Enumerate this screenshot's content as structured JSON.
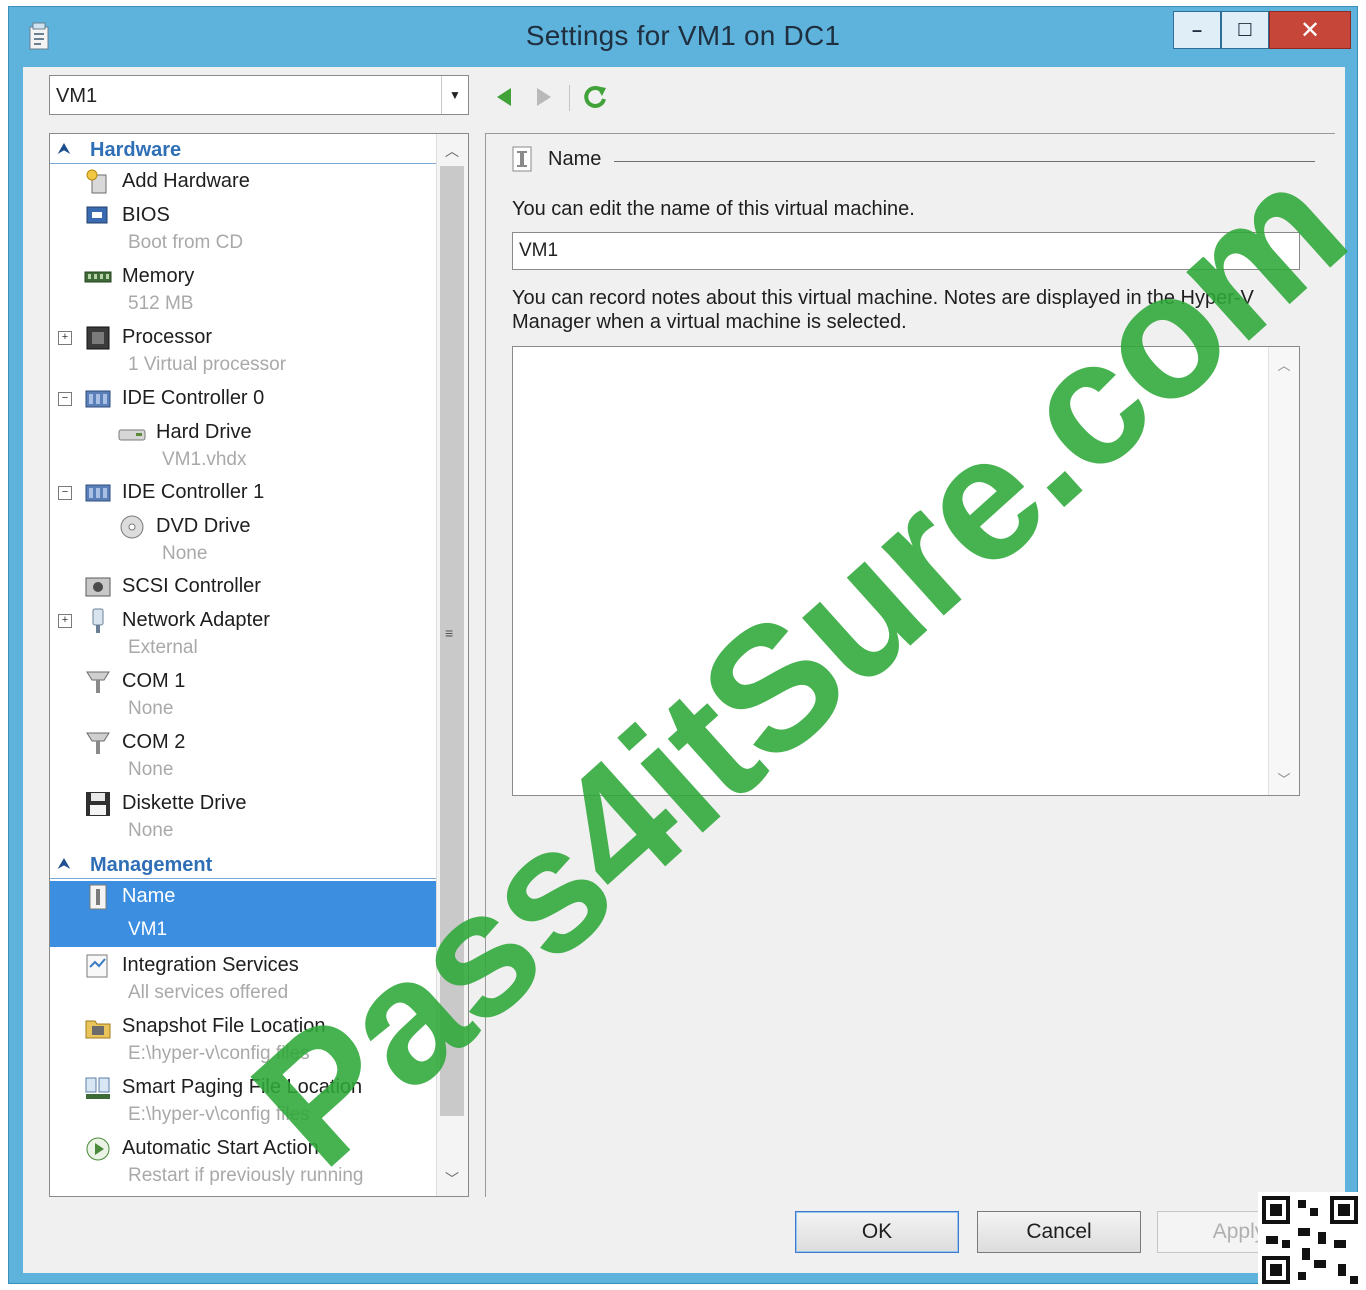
{
  "window": {
    "title": "Settings for VM1 on DC1",
    "controls": {
      "minimize": "–",
      "maximize": "☐",
      "close": "✕"
    }
  },
  "vm_selector": {
    "value": "VM1"
  },
  "tree": {
    "categories": [
      {
        "label": "Hardware"
      },
      {
        "label": "Management"
      }
    ],
    "hardware_items": [
      {
        "label": "Add Hardware",
        "sub": "",
        "icon": "add-hardware-icon"
      },
      {
        "label": "BIOS",
        "sub": "Boot from CD",
        "icon": "bios-icon"
      },
      {
        "label": "Memory",
        "sub": "512 MB",
        "icon": "memory-icon"
      },
      {
        "label": "Processor",
        "sub": "1 Virtual processor",
        "icon": "processor-icon",
        "expander": "+"
      },
      {
        "label": "IDE Controller 0",
        "sub": "",
        "icon": "ide-controller-icon",
        "expander": "−"
      },
      {
        "label": "Hard Drive",
        "sub": "VM1.vhdx",
        "icon": "hard-drive-icon"
      },
      {
        "label": "IDE Controller 1",
        "sub": "",
        "icon": "ide-controller-icon",
        "expander": "−"
      },
      {
        "label": "DVD Drive",
        "sub": "None",
        "icon": "dvd-drive-icon"
      },
      {
        "label": "SCSI Controller",
        "sub": "",
        "icon": "scsi-controller-icon"
      },
      {
        "label": "Network Adapter",
        "sub": "External",
        "icon": "network-adapter-icon",
        "expander": "+"
      },
      {
        "label": "COM 1",
        "sub": "None",
        "icon": "com-port-icon"
      },
      {
        "label": "COM 2",
        "sub": "None",
        "icon": "com-port-icon"
      },
      {
        "label": "Diskette Drive",
        "sub": "None",
        "icon": "diskette-drive-icon"
      }
    ],
    "management_items": [
      {
        "label": "Name",
        "sub": "VM1",
        "icon": "name-icon",
        "selected": true
      },
      {
        "label": "Integration Services",
        "sub": "All services offered",
        "icon": "integration-services-icon"
      },
      {
        "label": "Snapshot File Location",
        "sub": "E:\\hyper-v\\config files",
        "icon": "snapshot-location-icon"
      },
      {
        "label": "Smart Paging File Location",
        "sub": "E:\\hyper-v\\config files",
        "icon": "smart-paging-icon"
      },
      {
        "label": "Automatic Start Action",
        "sub": "Restart if previously running",
        "icon": "automatic-start-icon"
      }
    ]
  },
  "panel": {
    "section_title": "Name",
    "name_description": "You can edit the name of this virtual machine.",
    "name_value": "VM1",
    "notes_description": "You can record notes about this virtual machine. Notes are displayed in the Hyper-V Manager when a virtual machine is selected.",
    "notes_value": ""
  },
  "buttons": {
    "ok": "OK",
    "cancel": "Cancel",
    "apply": "Apply"
  },
  "watermark": "Pass4itSure.com",
  "colors": {
    "titlebar": "#5eb3dc",
    "selection": "#3c8ee0",
    "category": "#2f6fb6",
    "close": "#c6463a",
    "watermark": "#2ea838"
  }
}
